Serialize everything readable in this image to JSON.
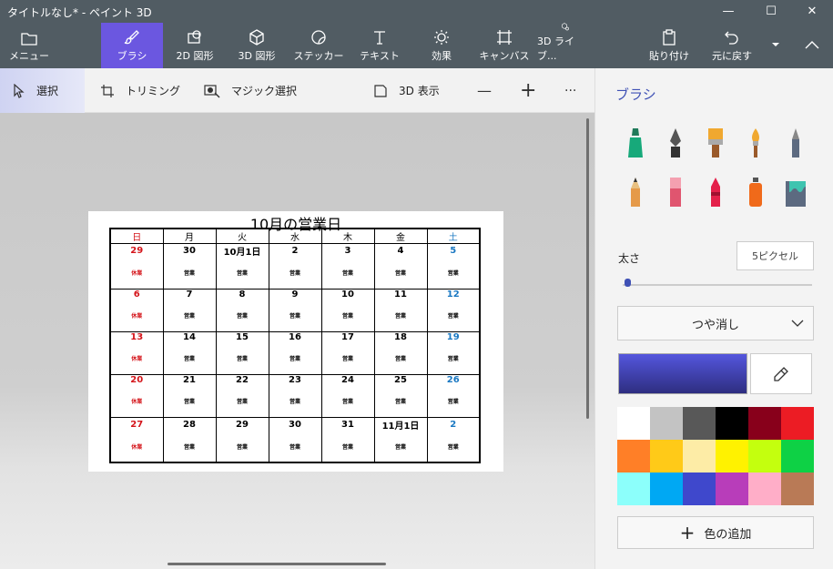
{
  "window": {
    "title": "タイトルなし* - ペイント 3D",
    "minimize": "—",
    "maximize": "☐",
    "close": "✕"
  },
  "toolbar": {
    "menu": "メニュー",
    "brush": "ブラシ",
    "shapes2d": "2D 図形",
    "shapes3d": "3D 図形",
    "stickers": "ステッカー",
    "text": "テキスト",
    "effects": "効果",
    "canvas": "キャンバス",
    "library3d": "3D ライブ...",
    "paste": "貼り付け",
    "undo": "元に戻す"
  },
  "subbar": {
    "select": "選択",
    "crop": "トリミング",
    "magic_select": "マジック選択",
    "view3d": "3D 表示",
    "zoom_out": "—",
    "zoom_in": "+",
    "more": "···"
  },
  "calendar": {
    "title": "10月の営業日",
    "headers": [
      "日",
      "月",
      "火",
      "水",
      "木",
      "金",
      "土"
    ],
    "weeks": [
      {
        "days": [
          "29",
          "30",
          "10月1日",
          "2",
          "3",
          "4",
          "5"
        ],
        "status": [
          "休業",
          "営業",
          "営業",
          "営業",
          "営業",
          "営業",
          "営業"
        ]
      },
      {
        "days": [
          "6",
          "7",
          "8",
          "9",
          "10",
          "11",
          "12"
        ],
        "status": [
          "休業",
          "営業",
          "営業",
          "営業",
          "営業",
          "営業",
          "営業"
        ]
      },
      {
        "days": [
          "13",
          "14",
          "15",
          "16",
          "17",
          "18",
          "19"
        ],
        "status": [
          "休業",
          "営業",
          "営業",
          "営業",
          "営業",
          "営業",
          "営業"
        ]
      },
      {
        "days": [
          "20",
          "21",
          "22",
          "23",
          "24",
          "25",
          "26"
        ],
        "status": [
          "休業",
          "営業",
          "営業",
          "営業",
          "営業",
          "営業",
          "営業"
        ]
      },
      {
        "days": [
          "27",
          "28",
          "29",
          "30",
          "31",
          "11月1日",
          "2"
        ],
        "status": [
          "休業",
          "営業",
          "営業",
          "営業",
          "営業",
          "営業",
          "営業"
        ]
      }
    ],
    "colors": {
      "sunday": "#d4141a",
      "saturday": "#1a78c2"
    }
  },
  "panel": {
    "title": "ブラシ",
    "brushes": [
      "marker-icon",
      "calligraphy-pen-icon",
      "oil-brush-icon",
      "watercolor-icon",
      "pixel-pen-icon",
      "pencil-icon",
      "eraser-icon",
      "crayon-icon",
      "spray-can-icon",
      "fill-bucket-icon"
    ],
    "thickness_label": "太さ",
    "thickness_value": "5ピクセル",
    "finish": "つや消し",
    "current_color": "#4446c0",
    "add_color": "色の追加",
    "palette": [
      "#ffffff",
      "#c3c3c3",
      "#585858",
      "#000000",
      "#88001b",
      "#ec1c24",
      "#ff7f27",
      "#ffca18",
      "#fdeca6",
      "#fff200",
      "#c4ff0e",
      "#0ed145",
      "#8cfffb",
      "#00a8f3",
      "#3f48cc",
      "#b83dba",
      "#ffaec8",
      "#b97a56"
    ]
  }
}
